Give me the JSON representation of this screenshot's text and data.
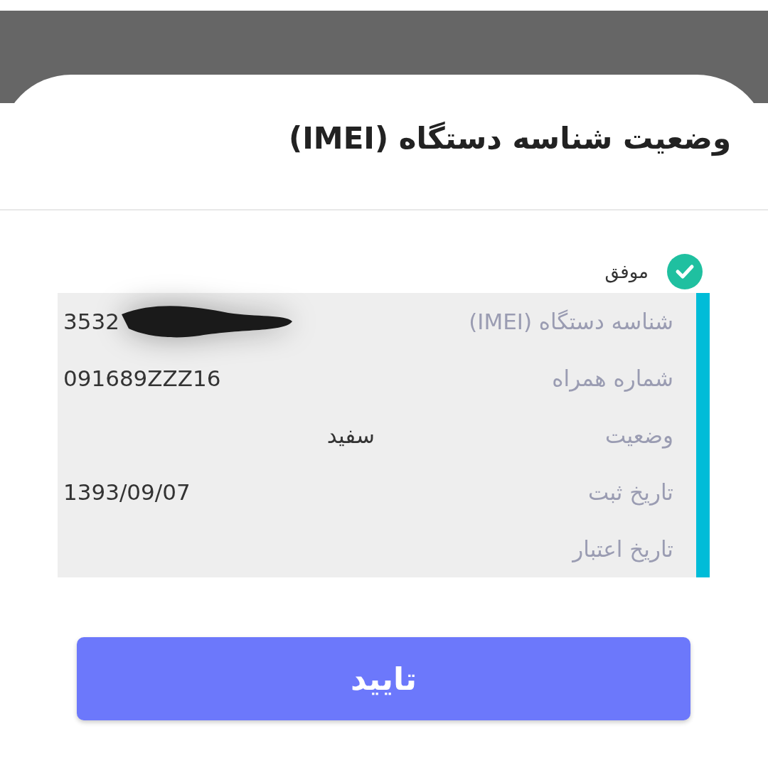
{
  "dialog": {
    "title": "وضعیت شناسه دستگاه (IMEI)"
  },
  "status": {
    "label": "موفق",
    "success": true
  },
  "rows": [
    {
      "label": "شناسه دستگاه (IMEI)",
      "value": "3532",
      "redacted": true
    },
    {
      "label": "شماره همراه",
      "value": "091689ZZZ16",
      "redacted": false
    },
    {
      "label": "وضعیت",
      "value": "سفید",
      "redacted": false
    },
    {
      "label": "تاریخ ثبت",
      "value": "1393/09/07",
      "redacted": false
    },
    {
      "label": "تاریخ اعتبار",
      "redacted": false
    }
  ],
  "confirm_button": {
    "label": "تایید"
  }
}
